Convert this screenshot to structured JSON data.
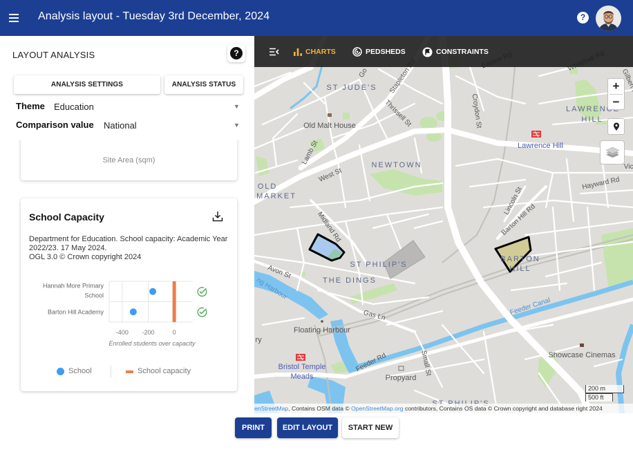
{
  "header": {
    "title": "Analysis layout - Tuesday 3rd December, 2024",
    "menu_icon": "menu-icon",
    "help_icon": "help-icon",
    "help_glyph": "?",
    "avatar": "user-avatar"
  },
  "panel": {
    "title": "LAYOUT ANALYSIS",
    "help_glyph": "?",
    "buttons": {
      "settings": "ANALYSIS SETTINGS",
      "status": "ANALYSIS STATUS"
    },
    "theme": {
      "label": "Theme",
      "value": "Education"
    },
    "comparison": {
      "label": "Comparison value",
      "value": "National"
    },
    "dropdown_glyph": "▼",
    "cards": [
      {
        "subtitle": "Site Area (sqm)"
      },
      {
        "title": "School Capacity",
        "download_icon": "download-icon",
        "source": "Department for Education. School capacity: Academic Year 2022/23. 17 May 2024.",
        "license": "OGL 3.0 © Crown copyright 2024",
        "legend": [
          {
            "label": "School",
            "marker": "dot"
          },
          {
            "label": "School capacity",
            "marker": "bar"
          }
        ]
      }
    ]
  },
  "map": {
    "toolbar": {
      "collapse_icon": "menu-open-icon",
      "items": [
        {
          "label": "CHARTS",
          "icon": "bar-chart-icon",
          "active": true
        },
        {
          "label": "PEDSHEDS",
          "icon": "pedshed-icon",
          "active": false
        },
        {
          "label": "CONSTRAINTS",
          "icon": "constraints-icon",
          "active": false
        }
      ]
    },
    "controls": {
      "zoom_in": "+",
      "zoom_out": "−",
      "locate_icon": "location-pin-icon",
      "layers_icon": "layers-icon"
    },
    "labels": [
      "ST JUDE'S",
      "Old Malt House",
      "Lamb St",
      "West St",
      "NEWTOWN",
      "OLD",
      "MARKET",
      "Stapleton Rd",
      "Thrissell St",
      "Croydon St",
      "Easton Rd",
      "Whitehall Rd",
      "Gilbert Rd",
      "LAWRENCE",
      "HILL",
      "Lawrence Hill",
      "Vict",
      "Hayward Rd",
      "Lincoln St",
      "Barton Hill Rd",
      "Midland Rd",
      "ST PHILIP'S",
      "THE DINGS",
      "Avon St",
      "Gas Ln",
      "Floating Harbour",
      "Feeder Rd",
      "Feeder Canal",
      "Bristol Temple",
      "Meads",
      "Propyard",
      "Small St",
      "Showcase Cinemas",
      "BARTON",
      "HILL",
      "ST PHILIP'S",
      "ry",
      "Go",
      "ng Harbour"
    ],
    "scale": {
      "metric": "200 m",
      "imperial": "500 ft"
    },
    "attribution": {
      "link1": "enStreetMap",
      "text1": ", Contains OSM data © ",
      "link2": "OpenStreetMap.org",
      "text2": " contributors, Contains OS data © Crown copyright and database right 2024"
    },
    "overlays": [
      {
        "name": "site-boundary-1",
        "fill": "#a9c9ee"
      },
      {
        "name": "site-boundary-2",
        "fill": "#d0c98e"
      },
      {
        "name": "grey-area",
        "fill": "#b3b2b0"
      }
    ]
  },
  "actions": {
    "print": "PRINT",
    "edit": "EDIT LAYOUT",
    "start_new": "START NEW"
  },
  "colors": {
    "primary": "#1c3f94",
    "toolbar_active": "#f2b531",
    "school_dot": "#3d9df5",
    "capacity": "#f07c48",
    "check": "#43a047"
  },
  "chart_data": {
    "type": "scatter",
    "title": "School Capacity",
    "categories": [
      "Hannah More Primary School",
      "Barton Hill Academy"
    ],
    "series": [
      {
        "name": "School",
        "values": [
          -165,
          -315
        ]
      },
      {
        "name": "School capacity",
        "values": [
          0,
          0
        ]
      }
    ],
    "xlabel": "Enrolled students over capacity",
    "ylabel": "",
    "xlim": [
      -500,
      100
    ],
    "xticks": [
      -400,
      -200,
      0
    ],
    "grid": true,
    "legend": "bottom",
    "status_icons": [
      "check-circle",
      "check-circle"
    ]
  }
}
